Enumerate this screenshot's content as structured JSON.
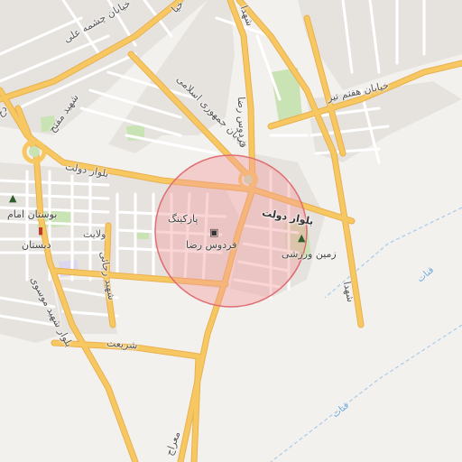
{
  "map": {
    "colors": {
      "background": "#f3f1ee",
      "major_road": "#f7c862",
      "major_road_casing": "#e8b04f",
      "minor_road": "#ffffff",
      "block": "#e6e3df",
      "park": "#c9e3b4",
      "water_line": "#a9cbe8",
      "highlight_fill": "#f29a9e",
      "highlight_stroke": "#e06d72"
    },
    "highlight": {
      "center": "Ferdows Reza",
      "label": "فردوس رضا"
    },
    "roads": [
      {
        "label": "خیابان چشمه علی",
        "type": "major"
      },
      {
        "label": "شهدا",
        "type": "major"
      },
      {
        "label": "شهید مفتح",
        "type": "major"
      },
      {
        "label": "خیابان جمهوری اسلامی",
        "type": "major"
      },
      {
        "label": "فردوس رضا",
        "type": "major"
      },
      {
        "label": "خیابان هفتم تیر",
        "type": "major"
      },
      {
        "label": "بلوار دولت",
        "type": "major"
      },
      {
        "label": "بلوار دولت",
        "type": "major"
      },
      {
        "label": "ولایت",
        "type": "minor"
      },
      {
        "label": "شهید رجائی",
        "type": "minor"
      },
      {
        "label": "شریعت",
        "type": "minor"
      },
      {
        "label": "بلوار شهید موسوی",
        "type": "major"
      },
      {
        "label": "شهدا",
        "type": "major"
      },
      {
        "label": "معراج",
        "type": "major"
      }
    ],
    "pois": [
      {
        "label": "بوستان امام",
        "icon": "tree-icon"
      },
      {
        "label": "دبستان",
        "icon": "school-icon"
      },
      {
        "label": "پارکینگ",
        "icon": "parking-icon"
      },
      {
        "label": "فردوس رضا",
        "icon": "landmark-icon"
      },
      {
        "label": "زمین ورزشی",
        "icon": "tree-icon"
      }
    ],
    "water": [
      {
        "label": "قنات"
      },
      {
        "label": "قنات"
      }
    ],
    "edge_labels": [
      "خیا",
      "دخ"
    ]
  }
}
